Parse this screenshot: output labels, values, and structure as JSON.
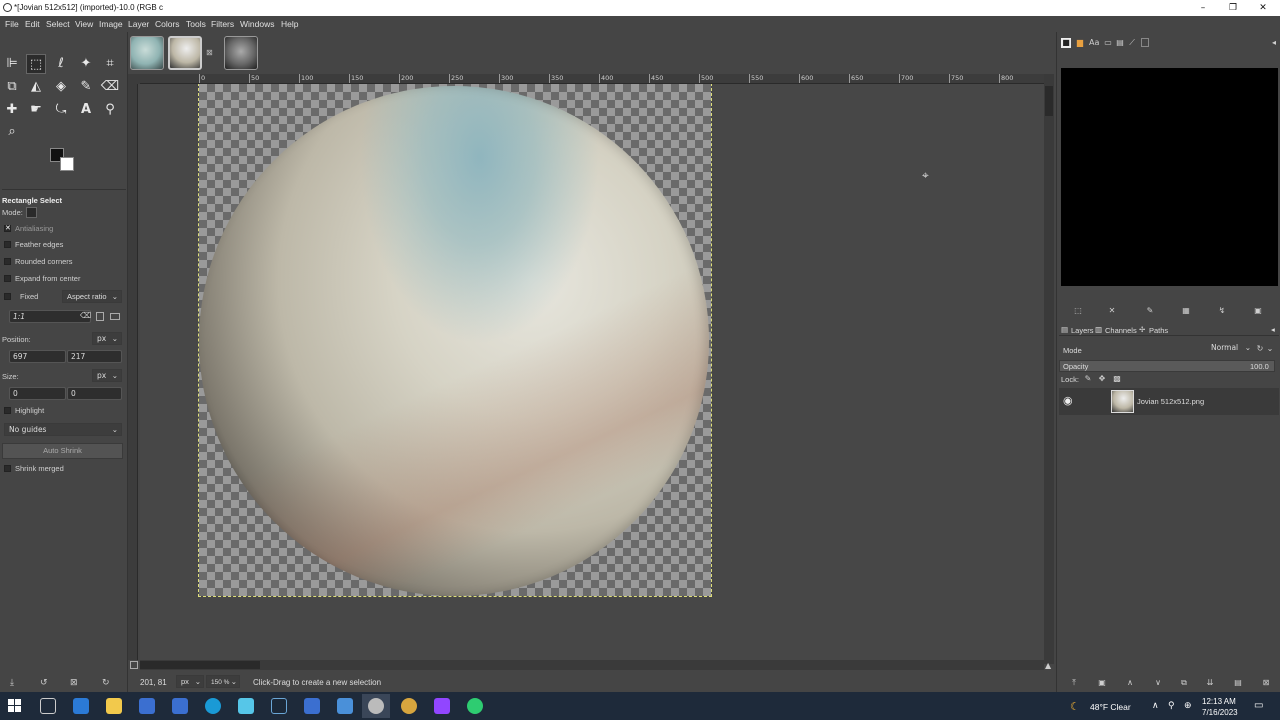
{
  "window": {
    "title": "*[Jovian 512x512] (imported)-10.0 (RGB c",
    "controls": [
      "–",
      "❐",
      "✕"
    ]
  },
  "menubar": [
    "File",
    "Edit",
    "Select",
    "View",
    "Image",
    "Layer",
    "Colors",
    "Tools",
    "Filters",
    "Windows",
    "Help"
  ],
  "tool_options": {
    "title": "Rectangle Select",
    "mode_label": "Mode:",
    "antialiasing": "Antialiasing",
    "feather_edges": "Feather edges",
    "rounded_corners": "Rounded corners",
    "expand_from_center": "Expand from center",
    "fixed_label": "Fixed",
    "aspect_ratio": "Aspect ratio",
    "ratio_value": "1:1",
    "position_label": "Position:",
    "position_unit": "px",
    "position_x": "697",
    "position_y": "217",
    "size_label": "Size:",
    "size_unit": "px",
    "size_w": "0",
    "size_h": "0",
    "highlight": "Highlight",
    "guides": "No guides",
    "auto_shrink": "Auto Shrink",
    "shrink_merged": "Shrink merged"
  },
  "ruler": {
    "labels": [
      "0",
      "50",
      "100",
      "150",
      "200",
      "250",
      "300",
      "350",
      "400",
      "450",
      "500",
      "550",
      "600",
      "650",
      "700",
      "750",
      "800"
    ]
  },
  "statusbar": {
    "coords": "201, 81",
    "unit": "px",
    "zoom": "150 %",
    "message": "Click-Drag to create a new selection"
  },
  "layers_panel": {
    "tabs": [
      "Layers",
      "Channels",
      "Paths"
    ],
    "mode_label": "Mode",
    "mode_value": "Normal",
    "opacity_label": "Opacity",
    "opacity_value": "100.0",
    "lock_label": "Lock:",
    "layer_name": "Jovian 512x512.png"
  },
  "taskbar": {
    "weather": "48°F  Clear",
    "time": "12:13 AM",
    "date": "7/16/2023"
  },
  "colors": {
    "accent_taskbar": "#1e2a3a",
    "fg_color": "#111111",
    "bg_color": "#ffffff"
  }
}
